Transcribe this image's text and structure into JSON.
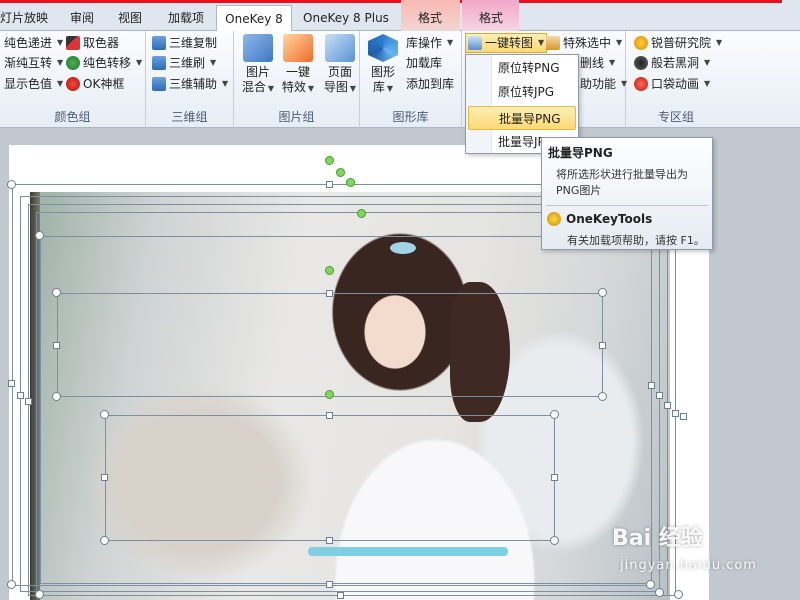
{
  "tabs": [
    {
      "label": "灯片放映"
    },
    {
      "label": "审阅"
    },
    {
      "label": "视图"
    },
    {
      "label": "加载项"
    },
    {
      "label": "OneKey 8",
      "active": true
    },
    {
      "label": "OneKey 8 Plus"
    },
    {
      "label": "格式",
      "context": "drawing"
    },
    {
      "label": "格式",
      "context": "picture"
    }
  ],
  "ribbon": {
    "color_group": {
      "label": "颜色组",
      "items": [
        "纯色递进",
        "渐纯互转",
        "显示色值",
        "取色器",
        "纯色转移",
        "OK神框"
      ]
    },
    "3d_group": {
      "label": "三维组",
      "items": [
        "三维复制",
        "三维刷",
        "三维辅助"
      ]
    },
    "image_group": {
      "label": "图片组",
      "buttons": [
        {
          "line1": "图片",
          "line2": "混合"
        },
        {
          "line1": "一键",
          "line2": "特效"
        },
        {
          "line1": "页面",
          "line2": "导图"
        }
      ]
    },
    "shape_lib_group": {
      "label": "图形库",
      "button": {
        "line1": "图形",
        "line2": "库"
      },
      "items": [
        "库操作",
        "加载库",
        "添加到库"
      ]
    },
    "convert_group": {
      "items": [
        "一键转图",
        "特殊选中",
        "删线",
        "助功能"
      ]
    },
    "special_group": {
      "label": "专区组",
      "items": [
        "锐普研究院",
        "般若黑洞",
        "口袋动画"
      ]
    }
  },
  "menu": {
    "items": [
      "原位转PNG",
      "原位转JPG",
      "批量导PNG",
      "批量导JPG"
    ],
    "highlighted": "批量导PNG"
  },
  "tooltip": {
    "title": "批量导PNG",
    "desc": "将所选形状进行批量导出为PNG图片",
    "brand": "OneKeyTools",
    "help": "有关加载项帮助，请按 F1。"
  },
  "watermark": {
    "main": "Bai 经验",
    "sub": "jingyan.baidu.com"
  },
  "colors": {
    "accent_red": "#e8101a",
    "tab_bg": "#dfe6ef",
    "ribbon_bg": "#f4f7fb",
    "highlight": "#fbd974"
  }
}
